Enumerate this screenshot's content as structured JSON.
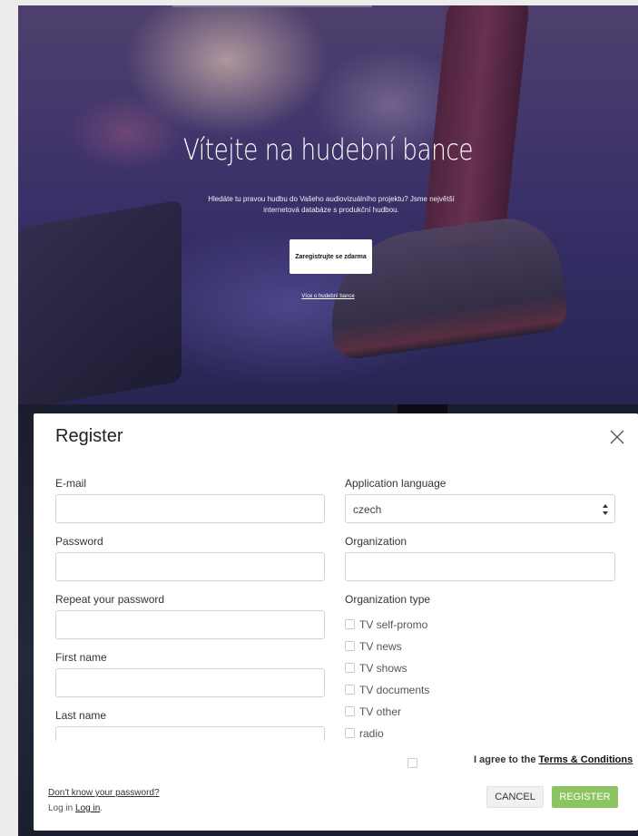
{
  "hero": {
    "title": "Vítejte na hudební bance",
    "subtitle": "Hledáte tu pravou hudbu do Vašeho audiovizuálního projektu? Jsme největší internetová databáze s produkční hudbou.",
    "cta_label": "Zaregistrujte se zdarma",
    "more_link": "Více o hudební bance"
  },
  "modal": {
    "title": "Register",
    "email_label": "E-mail",
    "password_label": "Password",
    "repeat_password_label": "Repeat your password",
    "first_name_label": "First name",
    "last_name_label": "Last name",
    "app_language_label": "Application language",
    "app_language_value": "czech",
    "organization_label": "Organization",
    "org_type_label": "Organization type",
    "org_types": [
      "TV self-promo",
      "TV news",
      "TV shows",
      "TV documents",
      "TV other",
      "radio"
    ],
    "terms_prefix": "I agree to the ",
    "terms_link": "Terms & Conditions",
    "forgot_password": "Don't know your password?",
    "login_prefix": "Log in ",
    "login_link": "Log in",
    "login_suffix": ".",
    "cancel_label": "CANCEL",
    "register_label": "REGISTER"
  },
  "colors": {
    "register_button": "#8cc460",
    "cancel_button": "#f1f1f1",
    "input_border": "#cfd4dc"
  },
  "icons": {
    "close": "close-icon",
    "select_arrows": "sort-arrows-icon"
  }
}
